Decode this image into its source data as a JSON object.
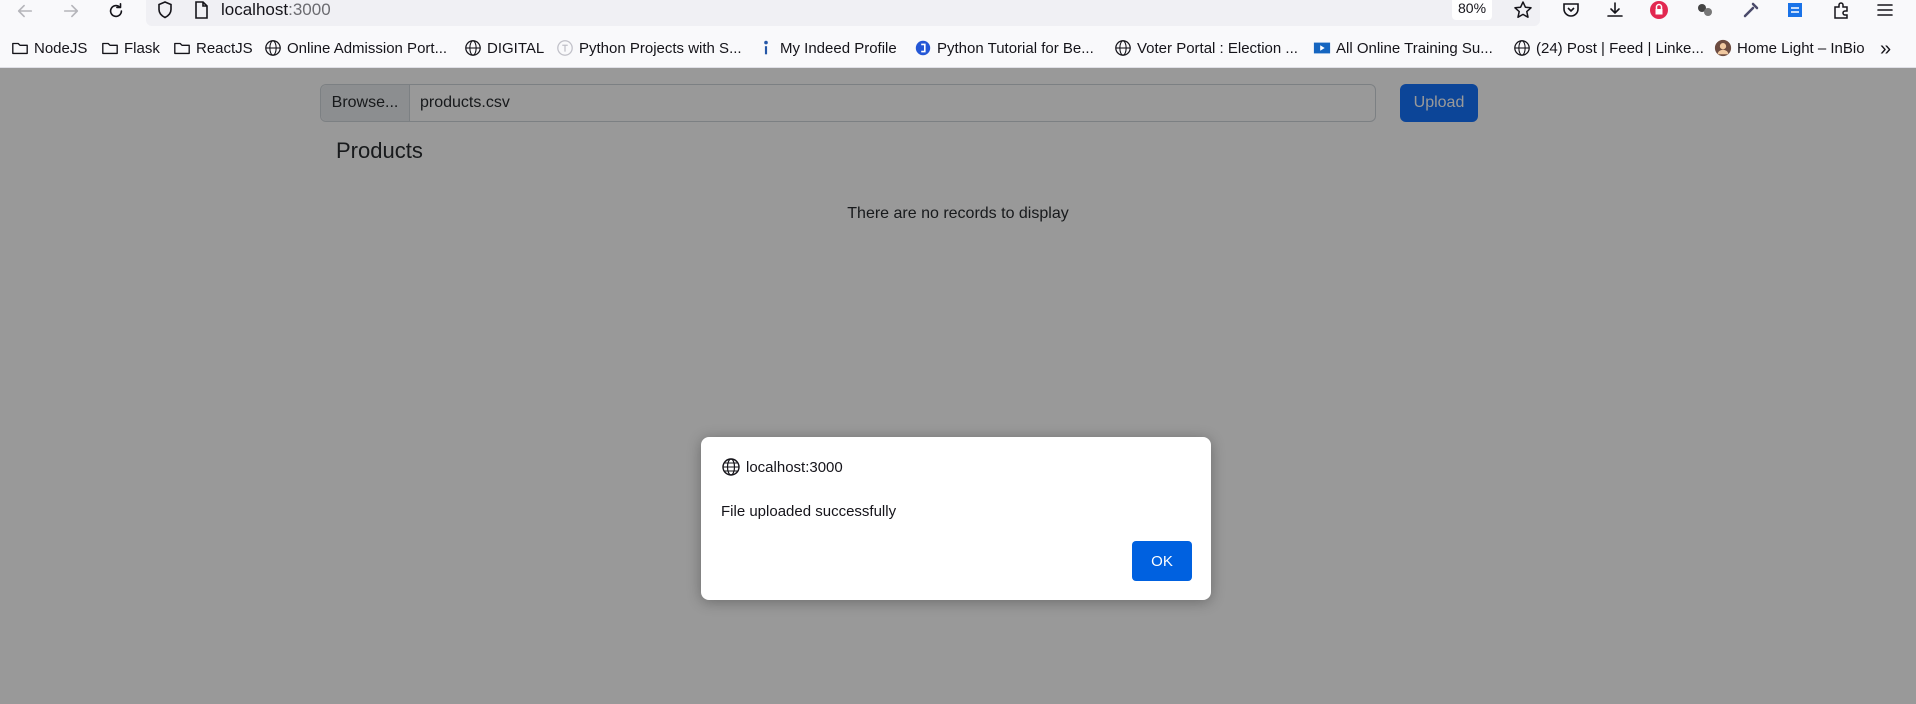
{
  "browser": {
    "url_host": "localhost",
    "url_port": ":3000",
    "zoom": "80%",
    "bookmarks": [
      {
        "label": "NodeJS",
        "icon": "folder-icon"
      },
      {
        "label": "Flask",
        "icon": "folder-icon"
      },
      {
        "label": "ReactJS",
        "icon": "folder-icon"
      },
      {
        "label": "Online Admission Port...",
        "icon": "globe-icon"
      },
      {
        "label": "DIGITAL",
        "icon": "globe-icon"
      },
      {
        "label": "Python Projects with S...",
        "icon": "site-t-icon"
      },
      {
        "label": "My Indeed Profile",
        "icon": "indeed-icon"
      },
      {
        "label": "Python Tutorial for Be...",
        "icon": "site-blue-icon"
      },
      {
        "label": "Voter Portal : Election ...",
        "icon": "globe-icon"
      },
      {
        "label": "All Online Training Su...",
        "icon": "video-icon"
      },
      {
        "label": "(24) Post | Feed | Linke...",
        "icon": "globe-icon"
      },
      {
        "label": "Home Light – InBio",
        "icon": "avatar-icon"
      }
    ]
  },
  "page": {
    "browse_label": "Browse...",
    "file_name": "products.csv",
    "upload_label": "Upload",
    "title": "Products",
    "empty_message": "There are no records to display"
  },
  "dialog": {
    "origin": "localhost:3000",
    "message": "File uploaded successfully",
    "ok_label": "OK"
  },
  "colors": {
    "primary": "#0d6efd",
    "dialog_ok": "#0061e0"
  }
}
